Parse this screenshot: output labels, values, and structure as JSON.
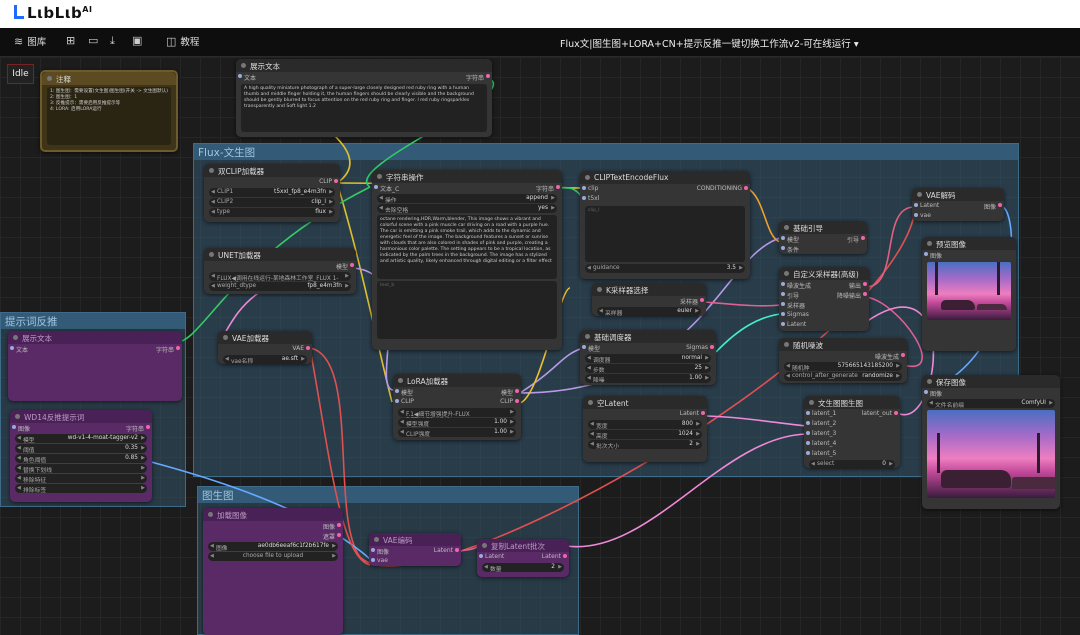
{
  "brand": {
    "name": "LιbLιb",
    "suffix": "AI"
  },
  "menubar": {
    "library_label": "图库",
    "tutorial_label": "教程",
    "workflow_title": "Flux文|图生图+LORA+CN+提示反推一键切换工作流v2-可在线运行"
  },
  "status": "Idle",
  "groups": {
    "t2i": "Flux-文生图",
    "prompt": "提示词反推",
    "i2i": "图生图"
  },
  "nodes": {
    "note": {
      "title": "注释",
      "lines": [
        "1: 图生图：需要设置(文生图)图生图(开关 -> 文生图默认)",
        "2: 图生图：1",
        "3: 反推提示：需要启用反推提示等",
        "4: LORA: 启用LORA运行"
      ]
    },
    "show_text": {
      "title": "展示文本",
      "in": "文本",
      "out": "字符串",
      "text": "A high quality miniature photograph of a super-large closely designed red ruby ring with a human thumb and middle finger holding it, the human fingers should be clearly visible and the background should be gently blurred to focus attention on the red ruby ring and finger. l red ruby ringsparkles transparently and Soft light 1.2"
    },
    "dual_clip": {
      "title": "双CLIP加载器",
      "out": "CLIP",
      "w": [
        [
          "CLIP1",
          "t5xxl_fp8_e4m3fn"
        ],
        [
          "CLIP2",
          "clip_l"
        ],
        [
          "type",
          "flux"
        ]
      ]
    },
    "string_op": {
      "title": "字符串操作",
      "in": "文本_C",
      "out": "字符串",
      "w": [
        [
          "操作",
          "append"
        ],
        [
          "去除空格",
          "yes"
        ]
      ],
      "text": "octane rendering,HDR,Warm,blender, This image shows a vibrant and colorful scene with a pink muscle car driving on a road with a purple hue. The car is emitting a pink smoke trail, which adds to the dynamic and energetic feel of the image. The background features a sunset or sunrise with clouds that are also colored in shades of pink and purple, creating a harmonious color palette. The setting appears to be a tropical location, as indicated by the palm trees in the background. The image has a stylized and artistic quality, likely enhanced through digital editing or a filter effect",
      "text_b": "text_b"
    },
    "clip_encode": {
      "title": "CLIPTextEncodeFlux",
      "in1": "clip",
      "in2": "t5xl",
      "out": "CONDITIONING",
      "guidance_label": "guidance",
      "guidance": "3.5",
      "clip_l": "clip_l"
    },
    "vae_decode": {
      "title": "VAE解码",
      "in1": "Latent",
      "in2": "vae",
      "out": "图像"
    },
    "unet": {
      "title": "UNET加载器",
      "out": "模型",
      "w": [
        [
          "",
          "FLUX◀调用在线运行-某地森林工作室_FLUX 1-dev-fp8"
        ],
        [
          "weight_dtype",
          "fp8_e4m3fn"
        ]
      ]
    },
    "basic_guider": {
      "title": "基础引导",
      "in1": "模型",
      "in2": "条件",
      "out": "引导"
    },
    "preview": {
      "title": "预览图像",
      "in": "图像"
    },
    "ksampler_select": {
      "title": "K采样器选择",
      "out": "采样器",
      "w": [
        [
          "采样器",
          "euler"
        ]
      ]
    },
    "custom_sampler": {
      "title": "自定义采样器(高级)",
      "in": [
        "噪波生成",
        "引导",
        "采样器",
        "Sigmas",
        "Latent"
      ],
      "out": [
        "输出",
        "降噪输出"
      ]
    },
    "vae_loader": {
      "title": "VAE加载器",
      "out": "VAE",
      "w": [
        [
          "vae名称",
          "ae.sft"
        ]
      ]
    },
    "basic_scheduler": {
      "title": "基础调度器",
      "in": "模型",
      "out": "Sigmas",
      "w": [
        [
          "调度器",
          "normal"
        ],
        [
          "步数",
          "25"
        ],
        [
          "降噪",
          "1.00"
        ]
      ]
    },
    "random_noise": {
      "title": "随机噪波",
      "out": "噪波生成",
      "w": [
        [
          "随机种",
          "575665143185200"
        ],
        [
          "control_after_generate",
          "randomize"
        ]
      ]
    },
    "lora": {
      "title": "LoRA加载器",
      "in1": "模型",
      "in2": "CLIP",
      "out1": "模型",
      "out2": "CLIP",
      "w": [
        [
          "",
          "F.1◀细节增强提升-FLUX DETAILER_V1.0"
        ],
        [
          "模型强度",
          "1.00"
        ],
        [
          "CLIP强度",
          "1.00"
        ]
      ]
    },
    "empty_latent": {
      "title": "空Latent",
      "out": "Latent",
      "w": [
        [
          "宽度",
          "800"
        ],
        [
          "高度",
          "1024"
        ],
        [
          "批次大小",
          "2"
        ]
      ]
    },
    "t2i_switch": {
      "title": "文生图图生图",
      "in": [
        "latent_1",
        "latent_2",
        "latent_3",
        "latent_4",
        "latent_5"
      ],
      "out": "latent_out",
      "w": [
        [
          "select",
          "0"
        ]
      ]
    },
    "save_image": {
      "title": "保存图像",
      "in": "图像",
      "w": [
        [
          "文件名前缀",
          "ComfyUI"
        ]
      ]
    },
    "p_show_text": {
      "title": "展示文本",
      "in": "文本",
      "out": "字符串"
    },
    "p_loader": {
      "title": "WD14反推提示词",
      "in": "图像",
      "out": "字符串",
      "w": [
        [
          "模型",
          "wd-v1-4-moat-tagger-v2"
        ],
        [
          "阈值",
          "0.35"
        ],
        [
          "角色阈值",
          "0.85"
        ],
        [
          "替换下划线",
          ""
        ],
        [
          "移除特征",
          ""
        ],
        [
          "排除标签",
          ""
        ]
      ]
    },
    "load_image": {
      "title": "加载图像",
      "out1": "图像",
      "out2": "遮罩",
      "w": [
        [
          "图像",
          "ae0db6eeaf6c1f2b617fe"
        ]
      ],
      "upload": "choose file to upload"
    },
    "vae_encode": {
      "title": "VAE编码",
      "in1": "图像",
      "in2": "vae",
      "out": "Latent"
    },
    "latent_batch": {
      "title": "复制Latent批次",
      "in": "Latent",
      "out": "Latent",
      "w": [
        [
          "数量",
          "2"
        ]
      ]
    }
  }
}
